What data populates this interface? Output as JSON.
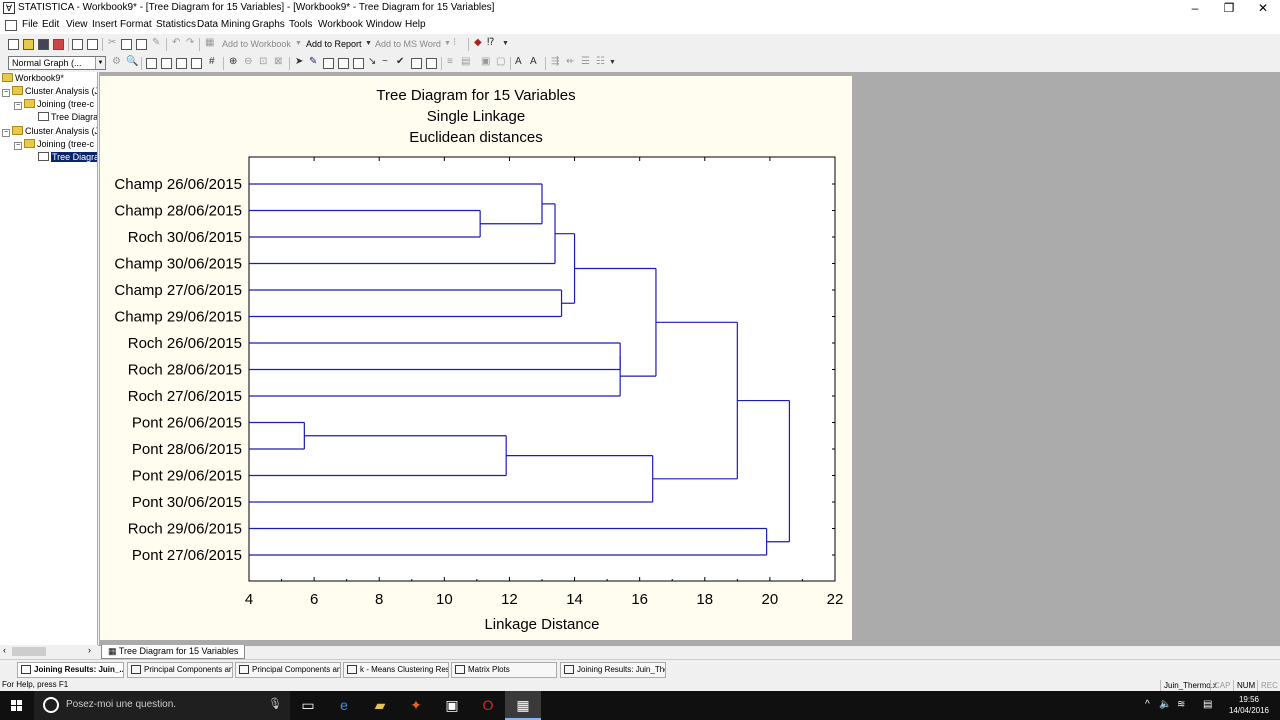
{
  "window": {
    "title": "STATISTICA - Workbook9* - [Tree Diagram for 15  Variables] - [Workbook9* - Tree Diagram for 15  Variables]",
    "app_icon": "statistica-icon",
    "controls": [
      "minimize",
      "restore",
      "close"
    ]
  },
  "menu": [
    "File",
    "Edit",
    "View",
    "Insert",
    "Format",
    "Statistics",
    "Data Mining",
    "Graphs",
    "Tools",
    "Workbook",
    "Window",
    "Help"
  ],
  "toolbar1": {
    "add_to_workbook": "Add to Workbook",
    "add_to_report": "Add to Report",
    "add_to_ms_word": "Add to MS Word"
  },
  "toolbar2": {
    "style_combo": "Normal Graph (..."
  },
  "tree": {
    "root": "Workbook9*",
    "items": [
      {
        "label": "Cluster Analysis (J",
        "level": 1
      },
      {
        "label": "Joining (tree-c",
        "level": 2
      },
      {
        "label": "Tree Diagra",
        "level": 3
      },
      {
        "label": "Cluster Analysis (J",
        "level": 1
      },
      {
        "label": "Joining (tree-c",
        "level": 2
      },
      {
        "label": "Tree Diagra",
        "level": 3,
        "selected": true
      }
    ]
  },
  "chart_data": {
    "type": "dendrogram",
    "title": "Tree Diagram for 15  Variables",
    "subtitle_1": "Single Linkage",
    "subtitle_2": "Euclidean distances",
    "xlabel": "Linkage Distance",
    "xlim": [
      4,
      22
    ],
    "xticks": [
      4,
      6,
      8,
      10,
      12,
      14,
      16,
      18,
      20,
      22
    ],
    "leaves": [
      "Champ 26/06/2015",
      "Champ 28/06/2015",
      "Roch 30/06/2015",
      "Champ 30/06/2015",
      "Champ 27/06/2015",
      "Champ 29/06/2015",
      "Roch 26/06/2015",
      "Roch 28/06/2015",
      "Roch 27/06/2015",
      "Pont 26/06/2015",
      "Pont 28/06/2015",
      "Pont 29/06/2015",
      "Pont 30/06/2015",
      "Roch 29/06/2015",
      "Pont 27/06/2015"
    ],
    "merges": [
      {
        "id": "n1",
        "a": 1,
        "b": 2,
        "height": 11.1
      },
      {
        "id": "n2",
        "a": 0,
        "b": "n1",
        "height": 13.0
      },
      {
        "id": "n3",
        "a": "n2",
        "b": 3,
        "height": 13.4
      },
      {
        "id": "n4",
        "a": 4,
        "b": 5,
        "height": 13.6
      },
      {
        "id": "n5",
        "a": "n3",
        "b": "n4",
        "height": 14.0
      },
      {
        "id": "n6",
        "a": 6,
        "b": 7,
        "height": 15.4
      },
      {
        "id": "n7",
        "a": "n6",
        "b": 8,
        "height": 15.4
      },
      {
        "id": "n8",
        "a": "n5",
        "b": "n7",
        "height": 16.5
      },
      {
        "id": "n9",
        "a": 9,
        "b": 10,
        "height": 5.7
      },
      {
        "id": "n10",
        "a": "n9",
        "b": 11,
        "height": 11.9
      },
      {
        "id": "n11",
        "a": "n10",
        "b": 12,
        "height": 16.4
      },
      {
        "id": "n12",
        "a": "n8",
        "b": "n11",
        "height": 19.0
      },
      {
        "id": "n13",
        "a": 13,
        "b": 14,
        "height": 19.9
      },
      {
        "id": "n14",
        "a": "n12",
        "b": "n13",
        "height": 20.6
      }
    ],
    "line_color": "#1c1cb4",
    "background": "#fffcf0"
  },
  "doc_tab": "Tree Diagram for 15  Variables",
  "window_tabs": [
    {
      "label": "Joining Results: Juin_...",
      "active": true
    },
    {
      "label": "Principal Components and ...",
      "active": false
    },
    {
      "label": "Principal Components and ...",
      "active": false
    },
    {
      "label": "k - Means Clustering Resul...",
      "active": false
    },
    {
      "label": "Matrix Plots",
      "active": false
    },
    {
      "label": "Joining Results: Juin_Ther...",
      "active": false
    }
  ],
  "status": {
    "help": "For Help, press F1",
    "file": "Juin_Thermo.x",
    "caps": "CAP",
    "num": "NUM",
    "rec": "REC"
  },
  "taskbar": {
    "search_placeholder": "Posez-moi une question.",
    "time": "19:56",
    "date": "14/04/2016"
  }
}
